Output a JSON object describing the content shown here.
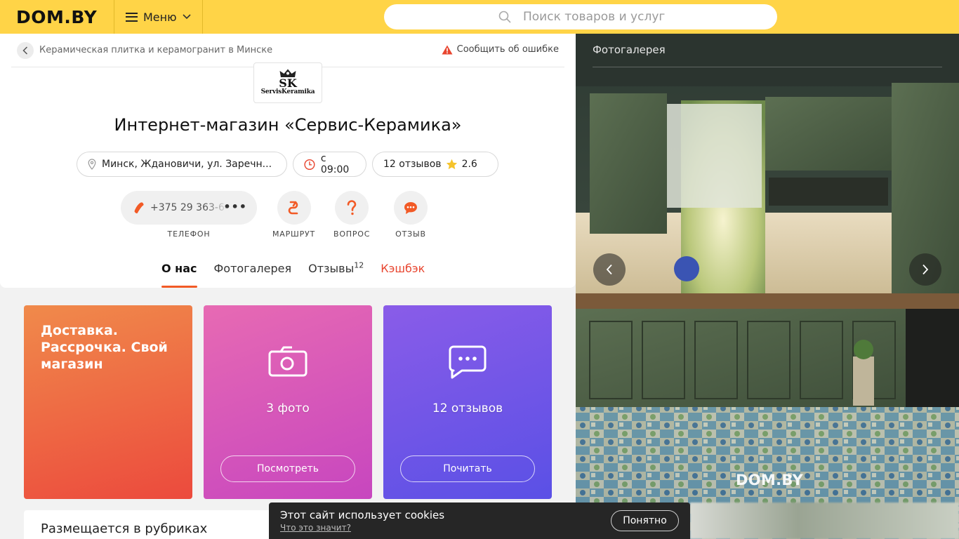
{
  "header": {
    "logo": "DOM.BY",
    "menu_label": "Меню",
    "search_placeholder": "Поиск товаров и услуг"
  },
  "breadcrumb": {
    "text": "Керамическая плитка и керамогранит в Минске",
    "report_label": "Сообщить об ошибке"
  },
  "company": {
    "logo_big": "SK",
    "logo_small": "ServisKeramika",
    "title": "Интернет-магазин «Сервис-Керамика»",
    "address": "Минск, Ждановичи, ул. Заречн...",
    "hours": "с 09:00",
    "reviews": "12 отзывов",
    "rating": "2.6",
    "phone": "+375 29 363-64",
    "phone_more": "•••",
    "actions": [
      {
        "label": "ТЕЛЕФОН"
      },
      {
        "label": "МАРШРУТ"
      },
      {
        "label": "ВОПРОС"
      },
      {
        "label": "ОТЗЫВ"
      }
    ]
  },
  "tabs": [
    {
      "label": "О нас",
      "active": true
    },
    {
      "label": "Фотогалерея"
    },
    {
      "label": "Отзывы",
      "count": "12"
    },
    {
      "label": "Кэшбэк"
    }
  ],
  "promos": [
    {
      "title": "Доставка. Рассрочка. Свой магазин"
    },
    {
      "count_text": "3 фото",
      "button": "Посмотреть"
    },
    {
      "count_text": "12 отзывов",
      "button": "Почитать"
    }
  ],
  "rubrics_title": "Размещается в рубриках",
  "gallery": {
    "title": "Фотогалерея",
    "watermark": "DOM.BY"
  },
  "cookie": {
    "message": "Этот сайт использует cookies",
    "link": "Что это значит?",
    "button": "Понятно"
  },
  "colors": {
    "header_bg": "#ffd447",
    "accent": "#f25a26",
    "cashback": "#e8452f"
  }
}
